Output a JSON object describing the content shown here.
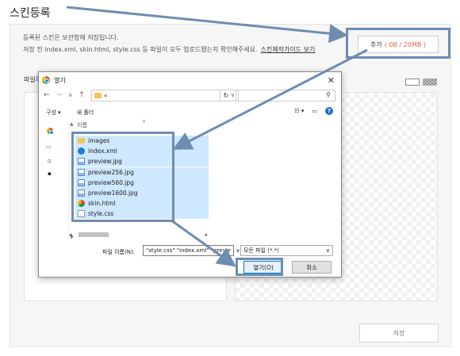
{
  "page": {
    "title": "스킨등록",
    "info_line1": "등록된 스킨은 보관함에 저장됩니다.",
    "info_line2": "저장 전 index.xml, skin.html, style.css 등 파일이 모두 업로드됐는지 확인해주세요.",
    "guide_link": "스킨제작가이드 보기",
    "add_button_label": "추가",
    "add_button_capacity": "( 0B / 20MB )",
    "file_area_label": "파일목",
    "save_button": "저장"
  },
  "dialog": {
    "title": "열기",
    "close_glyph": "✕",
    "address": "«",
    "toolbar_organize": "구성 ▾",
    "toolbar_new_folder": "새 폴더",
    "column_name": "이름",
    "files": [
      {
        "name": "images",
        "icon": "folder-icon"
      },
      {
        "name": "index.xml",
        "icon": "edge-file-icon"
      },
      {
        "name": "preview.jpg",
        "icon": "image-file-icon"
      },
      {
        "name": "preview256.jpg",
        "icon": "image-file-icon"
      },
      {
        "name": "preview560.jpg",
        "icon": "image-file-icon"
      },
      {
        "name": "preview1600.jpg",
        "icon": "image-file-icon"
      },
      {
        "name": "skin.html",
        "icon": "chrome-file-icon"
      },
      {
        "name": "style.css",
        "icon": "css-file-icon"
      }
    ],
    "filename_label": "파일 이름(N):",
    "filename_value": "\"style.css\" \"index.xml\" \"previe",
    "filetype_value": "모든 파일 (*.*)",
    "open_button": "열기(O)",
    "cancel_button": "취소"
  },
  "colors": {
    "annotation": "#6f8db1",
    "selection": "#cde8ff",
    "capacity": "#e06040"
  }
}
